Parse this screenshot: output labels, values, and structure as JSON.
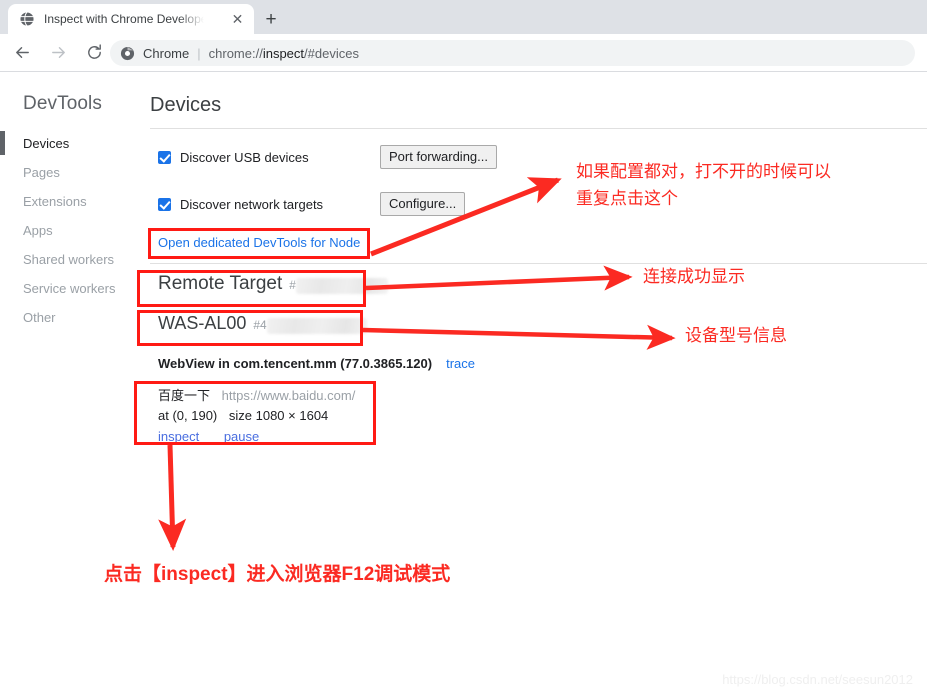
{
  "browser": {
    "tab": {
      "title": "Inspect with Chrome Developer Tools",
      "favicon_icon": "globe-icon",
      "close_icon": "✕",
      "newtab_icon": "+"
    },
    "toolbar": {
      "back_icon": "←",
      "forward_icon": "→",
      "reload_icon": "⟳",
      "omnibox": {
        "site_icon": "chrome-logo-icon",
        "scheme_label": "Chrome",
        "separator": "|",
        "url_prefix": "chrome://",
        "url_bold": "inspect",
        "url_suffix": "/#devices"
      }
    }
  },
  "sidebar": {
    "title": "DevTools",
    "items": [
      {
        "label": "Devices",
        "active": true
      },
      {
        "label": "Pages",
        "active": false
      },
      {
        "label": "Extensions",
        "active": false
      },
      {
        "label": "Apps",
        "active": false
      },
      {
        "label": "Shared workers",
        "active": false
      },
      {
        "label": "Service workers",
        "active": false
      },
      {
        "label": "Other",
        "active": false
      }
    ]
  },
  "main": {
    "heading": "Devices",
    "discover_usb": {
      "label": "Discover USB devices",
      "checked": true
    },
    "port_forwarding_button": "Port forwarding...",
    "discover_network": {
      "label": "Discover network targets",
      "checked": true
    },
    "configure_button": "Configure...",
    "node_link": "Open dedicated DevTools for Node",
    "remote_target": {
      "title": "Remote Target",
      "hash": "#"
    },
    "device": {
      "name": "WAS-AL00",
      "hash": "#4"
    },
    "webview": {
      "text": "WebView in com.tencent.mm (77.0.3865.120)",
      "trace_label": "trace"
    },
    "target_card": {
      "page_title": "百度一下",
      "page_url": "https://www.baidu.com/",
      "position": "at (0, 190)",
      "size": "size 1080 × 1604",
      "inspect_label": "inspect",
      "pause_label": "pause"
    }
  },
  "annotations": {
    "accent_color": "#fb2a22",
    "note_reopen": "如果配置都对，打不开的时候可以\n重复点击这个",
    "note_connected": "连接成功显示",
    "note_device_model": "设备型号信息",
    "note_inspect": "点击【inspect】进入浏览器F12调试模式"
  },
  "watermark": "https://blog.csdn.net/seesun2012"
}
